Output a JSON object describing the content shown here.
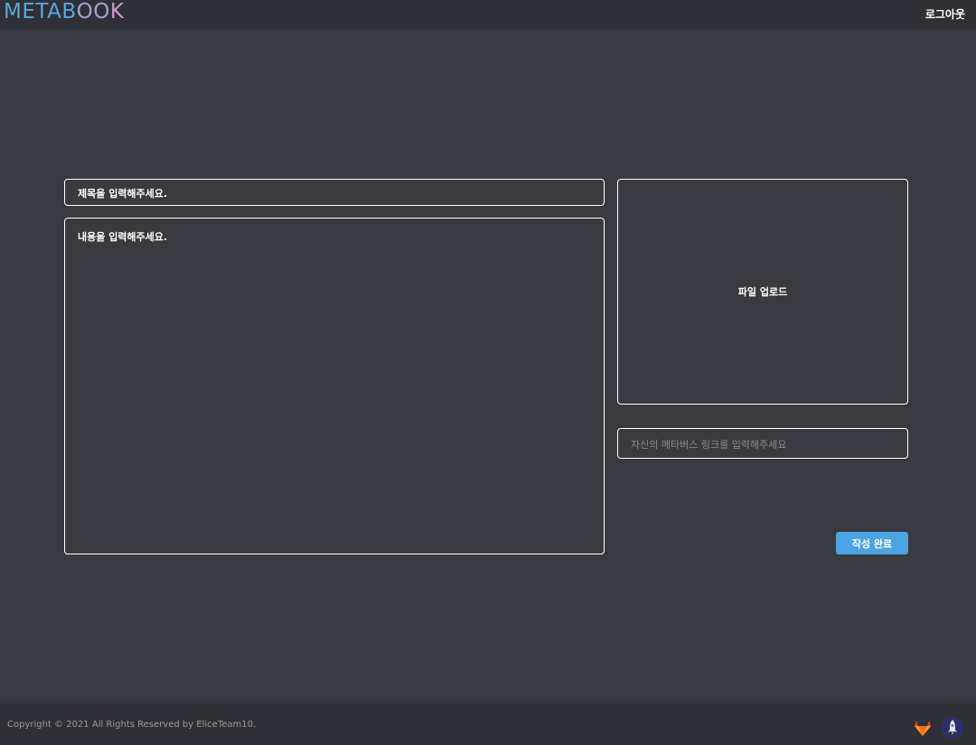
{
  "header": {
    "logo": {
      "part1": "METAB",
      "part2": "OO",
      "part3": "K"
    },
    "logout_label": "로그아웃"
  },
  "form": {
    "title_placeholder": "제목을 입력해주세요.",
    "content_placeholder": "내용을 입력해주세요.",
    "upload_label": "파일 업로드",
    "link_placeholder": "자신의 메타버스 링크를 입력해주세요",
    "submit_label": "작성 완료"
  },
  "footer": {
    "copyright": "Copyright © 2021 All Rights Reserved by EliceTeam10.",
    "icons": [
      "gitlab-icon",
      "rocket-icon"
    ]
  },
  "colors": {
    "background": "#393a3f",
    "header_footer": "#2f3035",
    "accent": "#4aa4e2",
    "logo_blue": "#56a8e0",
    "logo_purple": "#c89ad6"
  }
}
